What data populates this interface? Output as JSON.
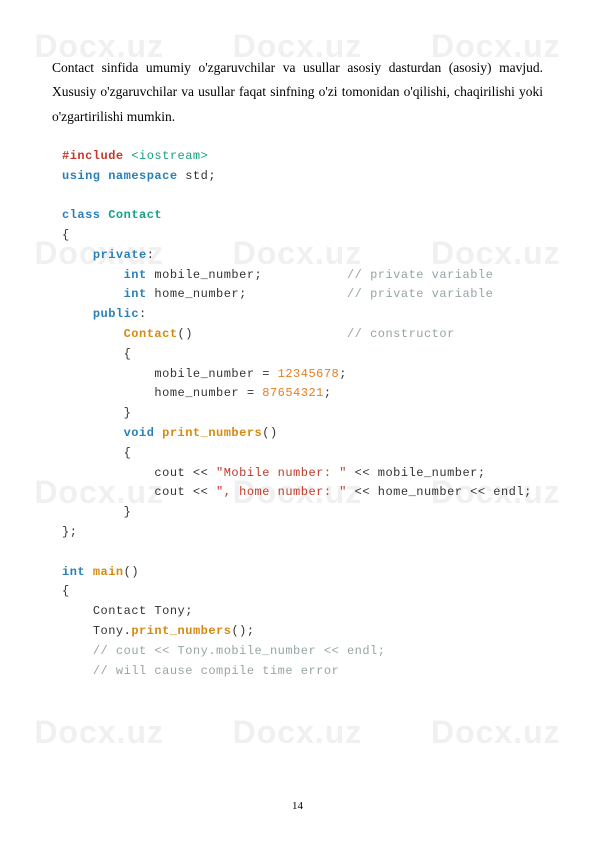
{
  "watermark": "Docx.uz",
  "paragraph": "Contact sinfida umumiy o'zgaruvchilar va usullar asosiy dasturdan (asosiy) mavjud. Xususiy o'zgaruvchilar va usullar faqat sinfning o'zi tomonidan o'qilishi, chaqirilishi yoki o'zgartirilishi mumkin.",
  "code": {
    "l1": {
      "a": "#include",
      "b": "<iostream>"
    },
    "l2": {
      "a": "using",
      "b": "namespace",
      "c": " std;"
    },
    "l3": "",
    "l4": {
      "a": "class",
      "b": "Contact"
    },
    "l5": "{",
    "l6": {
      "indent": "    ",
      "a": "private",
      "b": ":"
    },
    "l7": {
      "indent": "        ",
      "a": "int",
      "b": " mobile_number;",
      "pad": "           ",
      "c": "// private variable"
    },
    "l8": {
      "indent": "        ",
      "a": "int",
      "b": " home_number;",
      "pad": "             ",
      "c": "// private variable"
    },
    "l9": {
      "indent": "    ",
      "a": "public",
      "b": ":"
    },
    "l10": {
      "indent": "        ",
      "a": "Contact",
      "b": "()",
      "pad": "                    ",
      "c": "// constructor"
    },
    "l11": {
      "indent": "        ",
      "a": "{"
    },
    "l12": {
      "indent": "            ",
      "a": "mobile_number = ",
      "b": "12345678",
      "c": ";"
    },
    "l13": {
      "indent": "            ",
      "a": "home_number = ",
      "b": "87654321",
      "c": ";"
    },
    "l14": {
      "indent": "        ",
      "a": "}"
    },
    "l15": {
      "indent": "        ",
      "a": "void",
      "b": "print_numbers",
      "c": "()"
    },
    "l16": {
      "indent": "        ",
      "a": "{"
    },
    "l17": {
      "indent": "            ",
      "a": "cout << ",
      "b": "\"Mobile number: \"",
      "c": " << mobile_number;"
    },
    "l18": {
      "indent": "            ",
      "a": "cout << ",
      "b": "\", home number: \"",
      "c": " << home_number << endl;"
    },
    "l19": {
      "indent": "        ",
      "a": "}"
    },
    "l20": "};",
    "l21": "",
    "l22": {
      "a": "int",
      "b": "main",
      "c": "()"
    },
    "l23": "{",
    "l24": {
      "indent": "    ",
      "a": "Contact Tony;"
    },
    "l25": {
      "indent": "    ",
      "a": "Tony.",
      "b": "print_numbers",
      "c": "();"
    },
    "l26": {
      "indent": "    ",
      "a": "// cout << Tony.mobile_number << endl;"
    },
    "l27": {
      "indent": "    ",
      "a": "// will cause compile time error"
    }
  },
  "pageNumber": "14"
}
